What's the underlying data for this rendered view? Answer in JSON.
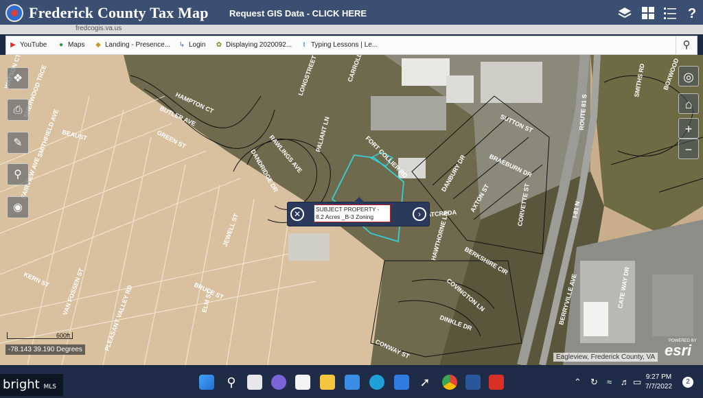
{
  "header": {
    "title": "Frederick County Tax Map",
    "gis_link": "Request GIS Data - CLICK HERE"
  },
  "browser": {
    "url_fragment": "fredcogis.va.us"
  },
  "bookmarks": [
    {
      "icon": "youtube-icon",
      "label": "YouTube"
    },
    {
      "icon": "maps-icon",
      "label": "Maps"
    },
    {
      "icon": "landing-icon",
      "label": "Landing - Presence..."
    },
    {
      "icon": "login-icon",
      "label": "Login"
    },
    {
      "icon": "leaf-icon",
      "label": "Displaying 2020092..."
    },
    {
      "icon": "typing-icon",
      "label": "Typing Lessons | Le..."
    }
  ],
  "map": {
    "streets": [
      "WATSON CT",
      "SHERWOOD TRCE",
      "HAMPTON CT",
      "BUTLER AVE",
      "SMITHFIELD AVE",
      "FAIRVIEW AVE",
      "BEAUST",
      "GREEN ST",
      "RAWLINGS AVE",
      "DANDRIDGE DR",
      "LONGSTREET",
      "CARROLL",
      "PALIANT LN",
      "FORT COLLIER RD",
      "DANBURY DR",
      "SUTTON ST",
      "BRAEBURN DR",
      "AXTON ST",
      "CORVETTE ST",
      "HAWTHORNE LN",
      "BERKSHIRE CIR",
      "COVINGTON LN",
      "DINKLE DR",
      "CONWAY ST",
      "BRUCE ST",
      "KERN ST",
      "VAN FOSSEN ST",
      "PLEASANT VALLEY RD",
      "JEWELL ST",
      "ELM ST",
      "BERRYVILLE AVE",
      "ROUTE 81 S",
      "I-81 N",
      "CATE WAY DR",
      "SMITHS RD",
      "BOXWOOD"
    ],
    "popup_text": "SUBJECT PROPERTY - 8.2 Acres _B-3 Zoning",
    "scale_label": "600ft",
    "coordinates": "-78.143 39.190 Degrees",
    "attribution": "Eagleview, Frederick County, VA",
    "esri_label": "esri",
    "esri_powered": "POWERED BY"
  },
  "taskbar": {
    "time": "9:27 PM",
    "date": "7/7/2022",
    "notification_count": "2"
  },
  "watermark": {
    "brand": "bright",
    "suffix": "MLS"
  },
  "colors": {
    "header_bg": "#3b4f72",
    "parcel_highlight": "#35d0d6",
    "popup_bg": "#2a3a5c",
    "taskbar_bg": "#1f2c47"
  }
}
